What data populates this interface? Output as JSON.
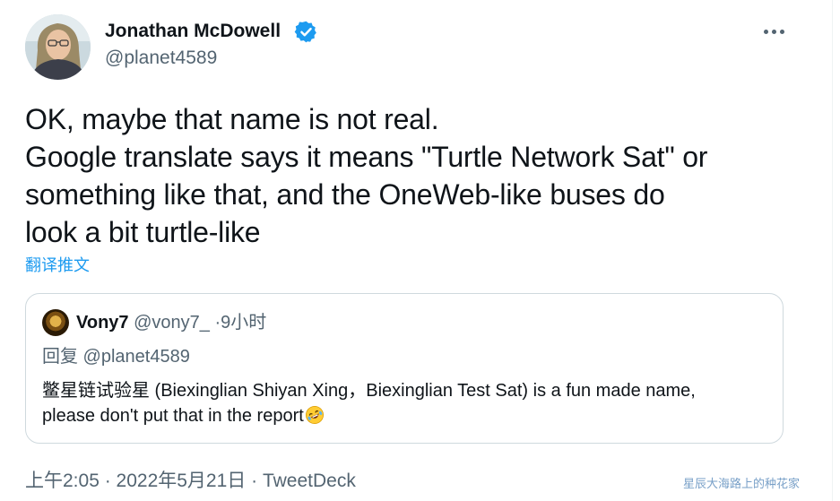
{
  "author": {
    "name": "Jonathan McDowell",
    "handle": "@planet4589",
    "verified": true,
    "avatar_icon": "portrait-avatar"
  },
  "tweet": {
    "lines": [
      "OK, maybe that name is not real.",
      "Google translate says it means \"Turtle Network Sat\" or",
      "something like that, and the OneWeb-like buses do",
      "look a bit turtle-like"
    ],
    "translate_label": "翻译推文"
  },
  "quote": {
    "name": "Vony7",
    "handle": "@vony7_",
    "separator": "·",
    "time": "9小时",
    "reply_to": "回复 @planet4589",
    "text_lines": [
      "鳖星链试验星 (Biexinglian Shiyan Xing，Biexinglian Test Sat) is a fun made name,",
      "please don't put that in the report"
    ],
    "emoji_icon": "rolling-on-floor-laughing-icon"
  },
  "meta": {
    "timestamp": "上午2:05 · 2022年5月21日 · TweetDeck"
  },
  "watermark": "星辰大海路上的种花家",
  "colors": {
    "accent": "#1d9bf0",
    "secondary_text": "#536471",
    "primary_text": "#0f1419",
    "border": "#cfd9de"
  }
}
